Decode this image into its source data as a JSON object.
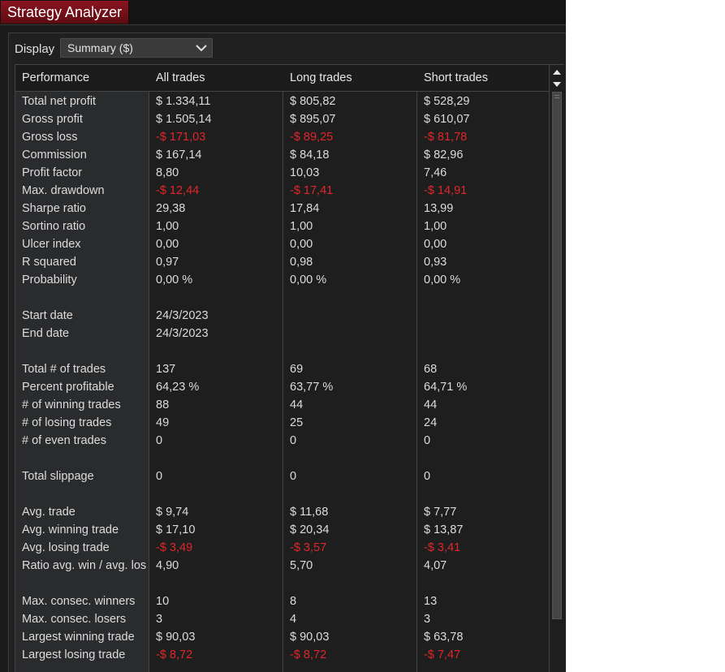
{
  "window": {
    "title": "Strategy Analyzer"
  },
  "display": {
    "label": "Display",
    "selected": "Summary ($)"
  },
  "table": {
    "headers": [
      "Performance",
      "All trades",
      "Long trades",
      "Short trades"
    ],
    "rows": [
      {
        "label": "Total net profit",
        "values": [
          "$ 1.334,11",
          "$ 805,82",
          "$ 528,29"
        ]
      },
      {
        "label": "Gross profit",
        "values": [
          "$ 1.505,14",
          "$ 895,07",
          "$ 610,07"
        ]
      },
      {
        "label": "Gross loss",
        "values": [
          "-$ 171,03",
          "-$ 89,25",
          "-$ 81,78"
        ],
        "negative": true
      },
      {
        "label": "Commission",
        "values": [
          "$ 167,14",
          "$ 84,18",
          "$ 82,96"
        ]
      },
      {
        "label": "Profit factor",
        "values": [
          "8,80",
          "10,03",
          "7,46"
        ]
      },
      {
        "label": "Max. drawdown",
        "values": [
          "-$ 12,44",
          "-$ 17,41",
          "-$ 14,91"
        ],
        "negative": true
      },
      {
        "label": "Sharpe ratio",
        "values": [
          "29,38",
          "17,84",
          "13,99"
        ]
      },
      {
        "label": "Sortino ratio",
        "values": [
          "1,00",
          "1,00",
          "1,00"
        ]
      },
      {
        "label": "Ulcer index",
        "values": [
          "0,00",
          "0,00",
          "0,00"
        ]
      },
      {
        "label": "R squared",
        "values": [
          "0,97",
          "0,98",
          "0,93"
        ]
      },
      {
        "label": "Probability",
        "values": [
          "0,00 %",
          "0,00 %",
          "0,00 %"
        ]
      },
      {
        "label": "",
        "values": [
          "",
          "",
          ""
        ]
      },
      {
        "label": "Start date",
        "values": [
          "24/3/2023",
          "",
          ""
        ]
      },
      {
        "label": "End date",
        "values": [
          "24/3/2023",
          "",
          ""
        ]
      },
      {
        "label": "",
        "values": [
          "",
          "",
          ""
        ]
      },
      {
        "label": "Total # of trades",
        "values": [
          "137",
          "69",
          "68"
        ]
      },
      {
        "label": "Percent profitable",
        "values": [
          "64,23 %",
          "63,77 %",
          "64,71 %"
        ]
      },
      {
        "label": "# of winning trades",
        "values": [
          "88",
          "44",
          "44"
        ]
      },
      {
        "label": "# of losing trades",
        "values": [
          "49",
          "25",
          "24"
        ]
      },
      {
        "label": "# of even trades",
        "values": [
          "0",
          "0",
          "0"
        ]
      },
      {
        "label": "",
        "values": [
          "",
          "",
          ""
        ]
      },
      {
        "label": "Total slippage",
        "values": [
          "0",
          "0",
          "0"
        ]
      },
      {
        "label": "",
        "values": [
          "",
          "",
          ""
        ]
      },
      {
        "label": "Avg. trade",
        "values": [
          "$ 9,74",
          "$ 11,68",
          "$ 7,77"
        ]
      },
      {
        "label": "Avg. winning trade",
        "values": [
          "$ 17,10",
          "$ 20,34",
          "$ 13,87"
        ]
      },
      {
        "label": "Avg. losing trade",
        "values": [
          "-$ 3,49",
          "-$ 3,57",
          "-$ 3,41"
        ],
        "negative": true
      },
      {
        "label": "Ratio avg. win / avg. los",
        "values": [
          "4,90",
          "5,70",
          "4,07"
        ]
      },
      {
        "label": "",
        "values": [
          "",
          "",
          ""
        ]
      },
      {
        "label": "Max. consec. winners",
        "values": [
          "10",
          "8",
          "13"
        ]
      },
      {
        "label": "Max. consec. losers",
        "values": [
          "3",
          "4",
          "3"
        ]
      },
      {
        "label": "Largest winning trade",
        "values": [
          "$ 90,03",
          "$ 90,03",
          "$ 63,78"
        ]
      },
      {
        "label": "Largest losing trade",
        "values": [
          "-$ 8,72",
          "-$ 8,72",
          "-$ 7,47"
        ],
        "negative": true
      }
    ]
  },
  "colors": {
    "title_tab": "#7a121b",
    "negative": "#e0262a",
    "text": "#dcdcdc",
    "background": "#1e1e1e"
  },
  "icons": {
    "dropdown": "chevron-down-icon",
    "scroll_up": "scroll-up-arrow-icon",
    "scroll_down": "scroll-down-arrow-icon"
  }
}
